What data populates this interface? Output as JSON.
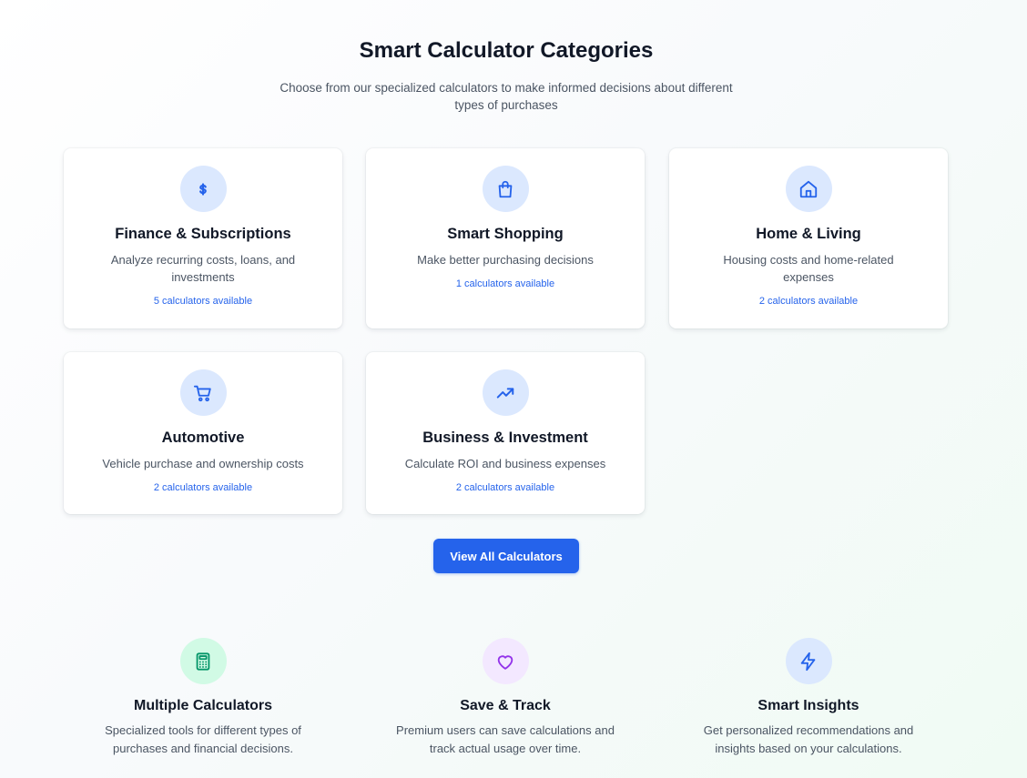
{
  "header": {
    "title": "Smart Calculator Categories",
    "subtitle": "Choose from our specialized calculators to make informed decisions about different types of purchases"
  },
  "categories": [
    {
      "title": "Finance & Subscriptions",
      "description": "Analyze recurring costs, loans, and investments",
      "count": "5 calculators available",
      "icon": "dollar-icon",
      "icon_bg": "#dbe8fe",
      "icon_color": "#2563eb"
    },
    {
      "title": "Smart Shopping",
      "description": "Make better purchasing decisions",
      "count": "1 calculators available",
      "icon": "shopping-bag-icon",
      "icon_bg": "#dbe8fe",
      "icon_color": "#2563eb"
    },
    {
      "title": "Home & Living",
      "description": "Housing costs and home-related expenses",
      "count": "2 calculators available",
      "icon": "home-icon",
      "icon_bg": "#dbe8fe",
      "icon_color": "#2563eb"
    },
    {
      "title": "Automotive",
      "description": "Vehicle purchase and ownership costs",
      "count": "2 calculators available",
      "icon": "cart-icon",
      "icon_bg": "#dbe8fe",
      "icon_color": "#2563eb"
    },
    {
      "title": "Business & Investment",
      "description": "Calculate ROI and business expenses",
      "count": "2 calculators available",
      "icon": "trending-up-icon",
      "icon_bg": "#dbe8fe",
      "icon_color": "#2563eb"
    }
  ],
  "cta": {
    "label": "View All Calculators",
    "color": "#2563eb"
  },
  "features": [
    {
      "title": "Multiple Calculators",
      "description": "Specialized tools for different types of purchases and financial decisions.",
      "icon": "calculator-icon",
      "icon_bg": "#d1fae5",
      "icon_color": "#059669"
    },
    {
      "title": "Save & Track",
      "description": "Premium users can save calculations and track actual usage over time.",
      "icon": "heart-icon",
      "icon_bg": "#f3e8ff",
      "icon_color": "#9333ea"
    },
    {
      "title": "Smart Insights",
      "description": "Get personalized recommendations and insights based on your calculations.",
      "icon": "lightning-icon",
      "icon_bg": "#dbe8fe",
      "icon_color": "#2563eb"
    }
  ]
}
